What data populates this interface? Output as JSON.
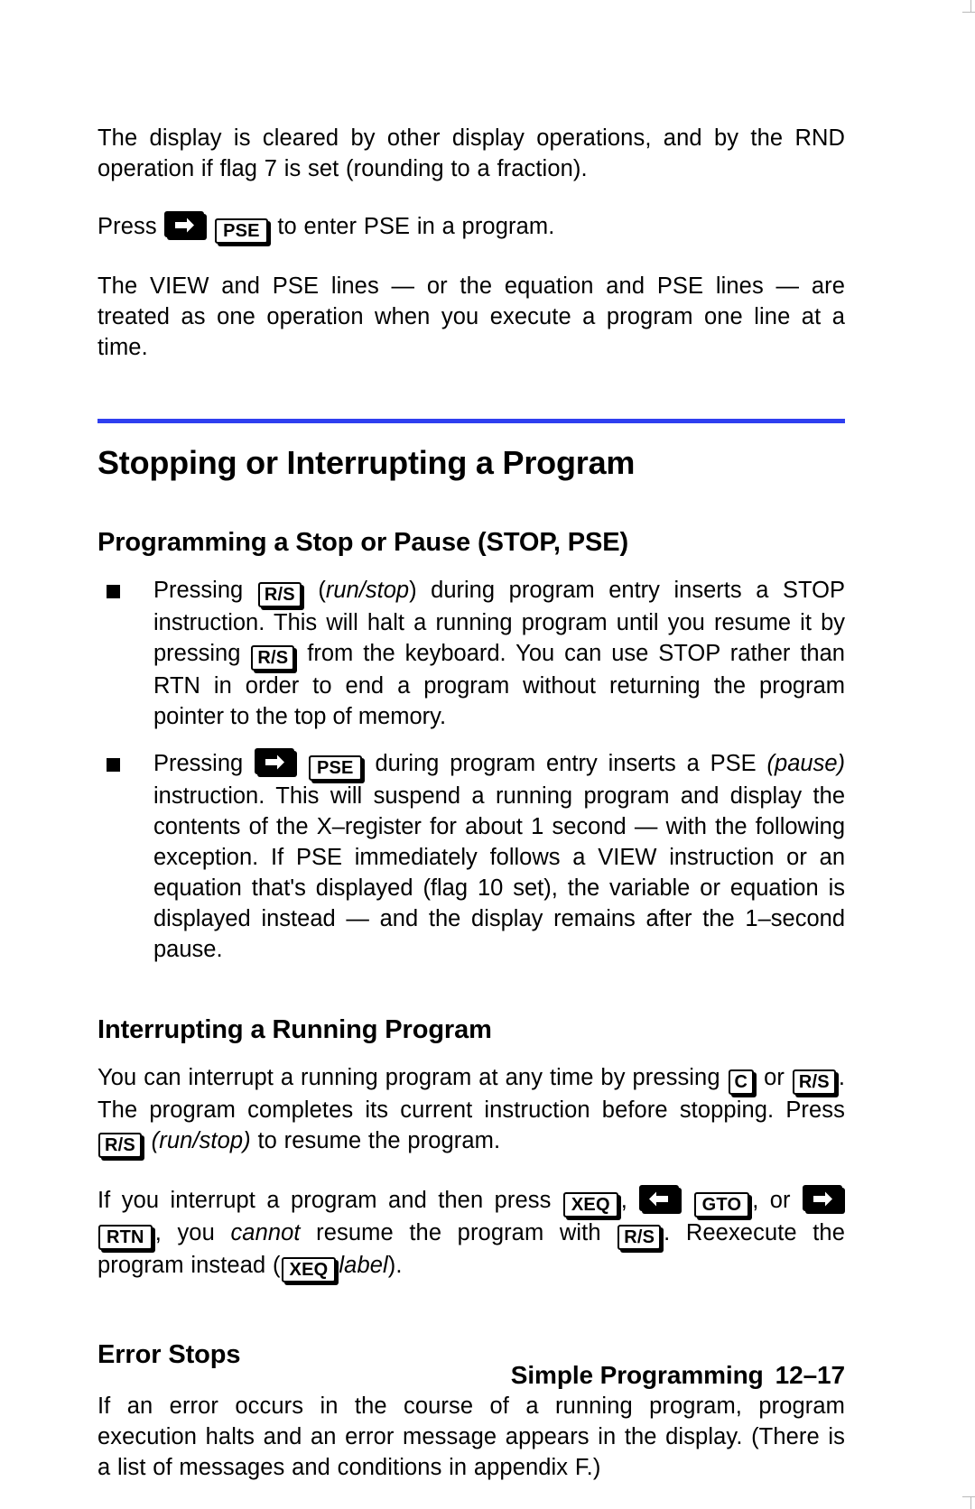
{
  "page": {
    "intro": {
      "para1": "The display is cleared by other display operations, and by the RND operation if flag 7 is set (rounding to a fraction).",
      "press_prefix": "Press",
      "press_suffix": "to enter PSE in a program.",
      "para3": "The VIEW and PSE lines — or the equation and PSE lines — are treated as one operation when you execute a program one line at a time."
    },
    "section_title": "Stopping or Interrupting a Program",
    "subsections": {
      "stop_pause": {
        "title": "Programming a Stop or Pause (STOP, PSE)",
        "bullets": [
          {
            "t1": "Pressing",
            "key1": "R/S",
            "t2": "(",
            "it1": "run/stop",
            "t3": ") during program entry inserts a STOP instruction. This will halt a running program until you resume it by pressing",
            "key2": "R/S",
            "t4": "from the keyboard. You can use STOP rather than RTN in order to end a program without returning the program pointer to the top of memory."
          },
          {
            "t1": "Pressing",
            "key1": "right-shift",
            "key2": "PSE",
            "t2": "during program entry inserts a PSE",
            "it1": "(pause)",
            "t3": "instruction. This will suspend a running program and display the contents of the X–register for about 1 second — with the following exception. If PSE immediately follows a VIEW instruction or an equation that's displayed (flag 10 set), the variable or equation is displayed instead — and the display remains after the 1–second pause."
          }
        ]
      },
      "interrupting": {
        "title": "Interrupting a Running Program",
        "para1_a": "You can interrupt a running program at any time by pressing",
        "para1_key1": "C",
        "para1_or": "or",
        "para1_key2": "R/S",
        "para1_b": ". The program completes its current instruction before stopping. Press",
        "para1_key3": "R/S",
        "para1_it": "(run/stop)",
        "para1_c": "to resume the program.",
        "para2_a": "If you interrupt a program and then press",
        "para2_key1": "XEQ",
        "para2_sep1": ",",
        "para2_key2": "left-shift",
        "para2_key3": "GTO",
        "para2_sep2": ", or",
        "para2_key4": "right-shift",
        "para2_key5": "RTN",
        "para2_b": ", you",
        "para2_it1": "cannot",
        "para2_c": "resume the program with",
        "para2_key6": "R/S",
        "para2_d": ". Reexecute the program instead (",
        "para2_key7": "XEQ",
        "para2_it2": "label",
        "para2_e": ")."
      },
      "error_stops": {
        "title": "Error Stops",
        "para1": "If an error occurs in the course of a running program, program execution halts and an error message appears in the display. (There is a list of messages and conditions in appendix F.)"
      }
    },
    "footer": {
      "chapter": "Simple Programming",
      "page_number": "12–17"
    },
    "colors": {
      "rule": "#2f3ff0",
      "text": "#000000",
      "background": "#ffffff"
    }
  }
}
